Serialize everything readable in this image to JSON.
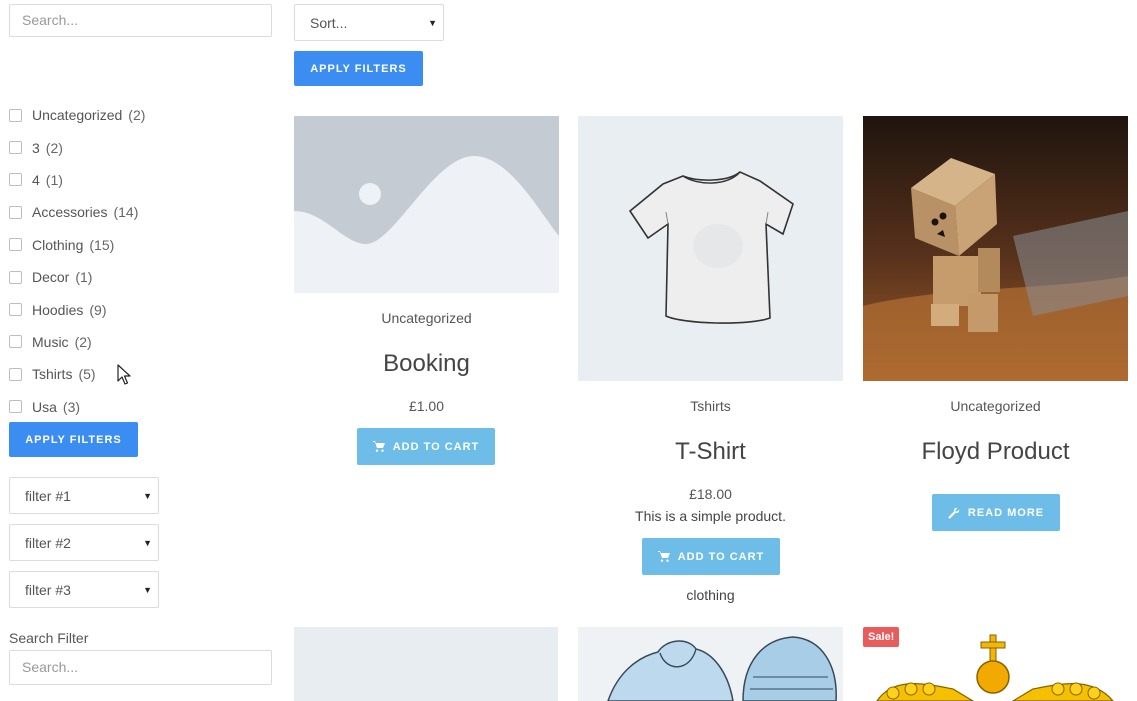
{
  "sidebar": {
    "search_placeholder": "Search...",
    "categories": [
      {
        "label": "Uncategorized",
        "count": "(2)"
      },
      {
        "label": "3",
        "count": "(2)"
      },
      {
        "label": "4",
        "count": "(1)"
      },
      {
        "label": "Accessories",
        "count": "(14)"
      },
      {
        "label": "Clothing",
        "count": "(15)"
      },
      {
        "label": "Decor",
        "count": "(1)"
      },
      {
        "label": "Hoodies",
        "count": "(9)"
      },
      {
        "label": "Music",
        "count": "(2)"
      },
      {
        "label": "Tshirts",
        "count": "(5)"
      },
      {
        "label": "Usa",
        "count": "(3)"
      }
    ],
    "apply_label": "APPLY FILTERS",
    "filters": [
      "filter #1",
      "filter #2",
      "filter #3"
    ],
    "search_filter_label": "Search Filter",
    "search_filter_placeholder": "Search..."
  },
  "toolbar": {
    "sort_label": "Sort...",
    "apply_label": "APPLY FILTERS"
  },
  "products": [
    {
      "category": "Uncategorized",
      "title": "Booking",
      "price": "£1.00",
      "button": "ADD TO CART"
    },
    {
      "category": "Tshirts",
      "title": "T-Shirt",
      "price": "£18.00",
      "description": "This is a simple product.",
      "button": "ADD TO CART",
      "tag": "clothing"
    },
    {
      "category": "Uncategorized",
      "title": "Floyd Product",
      "button": "READ MORE"
    }
  ],
  "sale_badge": "Sale!",
  "colors": {
    "primary": "#3b8df2",
    "cart": "#6dbde8",
    "sale": "#e85c5c"
  }
}
